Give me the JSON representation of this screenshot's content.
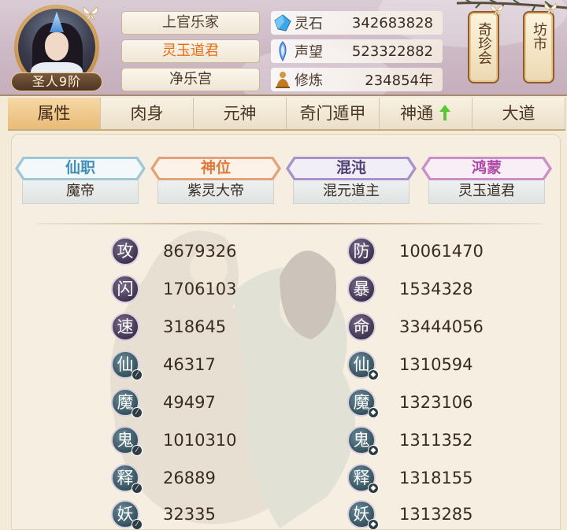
{
  "header": {
    "rank_badge": "圣人9阶",
    "names": [
      "上官乐家",
      "灵玉道君",
      "净乐宫"
    ],
    "resources": [
      {
        "label": "灵石",
        "value": "342683828",
        "icon": "spirit-stone-icon"
      },
      {
        "label": "声望",
        "value": "523322882",
        "icon": "prestige-icon"
      },
      {
        "label": "修炼",
        "value": "234854年",
        "icon": "cultivation-icon"
      }
    ],
    "side_buttons": [
      {
        "label": "奇珍会"
      },
      {
        "label": "坊市"
      }
    ]
  },
  "tabs": [
    {
      "label": "属性",
      "active": true
    },
    {
      "label": "肉身"
    },
    {
      "label": "元神"
    },
    {
      "label": "奇门遁甲"
    },
    {
      "label": "神通",
      "arrow": "up-arrow-icon"
    },
    {
      "label": "大道"
    }
  ],
  "titles": [
    {
      "heading": "仙职",
      "value": "魔帝"
    },
    {
      "heading": "神位",
      "value": "紫灵大帝"
    },
    {
      "heading": "混沌",
      "value": "混元道主"
    },
    {
      "heading": "鸿蒙",
      "value": "灵玉道君"
    }
  ],
  "stats_left": [
    {
      "icon": "攻",
      "value": "8679326"
    },
    {
      "icon": "闪",
      "value": "1706103"
    },
    {
      "icon": "速",
      "value": "318645"
    },
    {
      "icon": "仙",
      "value": "46317"
    },
    {
      "icon": "魔",
      "value": "49497"
    },
    {
      "icon": "鬼",
      "value": "1010310"
    },
    {
      "icon": "释",
      "value": "26889"
    },
    {
      "icon": "妖",
      "value": "32335"
    }
  ],
  "stats_right": [
    {
      "icon": "防",
      "value": "10061470"
    },
    {
      "icon": "暴",
      "value": "1534328"
    },
    {
      "icon": "命",
      "value": "33444056"
    },
    {
      "icon": "仙",
      "value": "1310594"
    },
    {
      "icon": "魔",
      "value": "1323106"
    },
    {
      "icon": "鬼",
      "value": "1311352"
    },
    {
      "icon": "释",
      "value": "1318155"
    },
    {
      "icon": "妖",
      "value": "1313285"
    }
  ]
}
